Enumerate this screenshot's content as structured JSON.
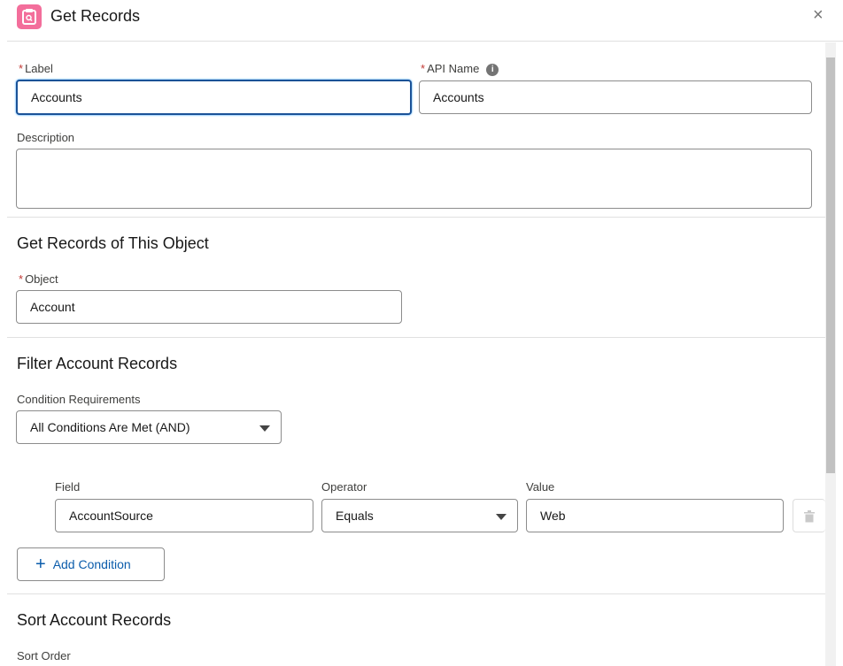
{
  "header": {
    "title": "Get Records",
    "icon": "get-records-icon",
    "close": "×"
  },
  "label": {
    "label": "Label",
    "value": "Accounts",
    "required": "*"
  },
  "api_name": {
    "label": "API Name",
    "value": "Accounts",
    "required": "*",
    "info": "i"
  },
  "description": {
    "label": "Description",
    "value": ""
  },
  "object_section": {
    "title": "Get Records of This Object",
    "object_label": "Object",
    "object_value": "Account",
    "required": "*"
  },
  "filter_section": {
    "title": "Filter Account Records",
    "condition_label": "Condition Requirements",
    "condition_value": "All Conditions Are Met (AND)",
    "columns": {
      "field": "Field",
      "operator": "Operator",
      "value": "Value"
    },
    "conditions": [
      {
        "field": "AccountSource",
        "operator": "Equals",
        "value": "Web"
      }
    ],
    "add_condition": "Add Condition"
  },
  "sort_section": {
    "title": "Sort Account Records",
    "sort_order_label": "Sort Order"
  },
  "colors": {
    "accent": "#0b5cab",
    "icon_bg": "#f36e9b",
    "required": "#c23934"
  }
}
